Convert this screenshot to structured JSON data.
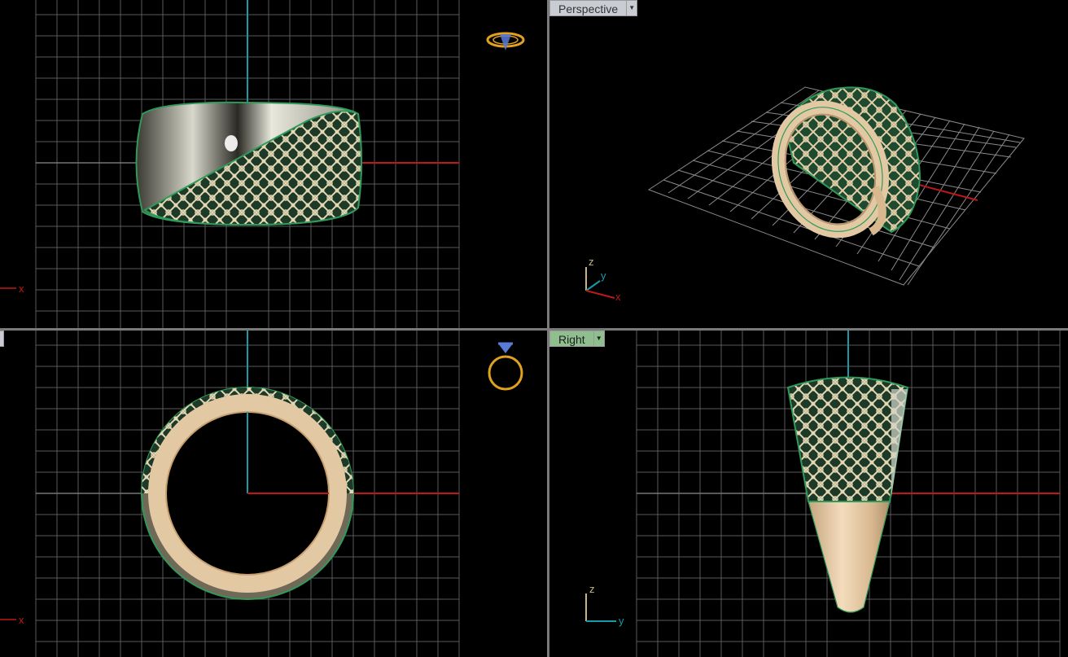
{
  "viewports": {
    "top": {
      "title": "",
      "axis_label_x": "x"
    },
    "perspective": {
      "title": "Perspective",
      "axis_z": "z",
      "axis_y": "y",
      "axis_x": "x"
    },
    "front": {
      "title": "",
      "axis_label_x": "x"
    },
    "right": {
      "title": "Right",
      "axis_z": "z",
      "axis_y": "y"
    }
  },
  "colors": {
    "grid": "#5a5a5a",
    "x_axis": "#c01818",
    "y_axis": "#1a9aa8",
    "selection": "#2f9a5a",
    "gold": "#e3c9a3",
    "silver": "#d6d7cc",
    "nav_widget": "#e0a020"
  },
  "icons": [
    "ring-widget-top-icon",
    "ring-widget-front-icon",
    "dropdown-arrow-icon"
  ]
}
